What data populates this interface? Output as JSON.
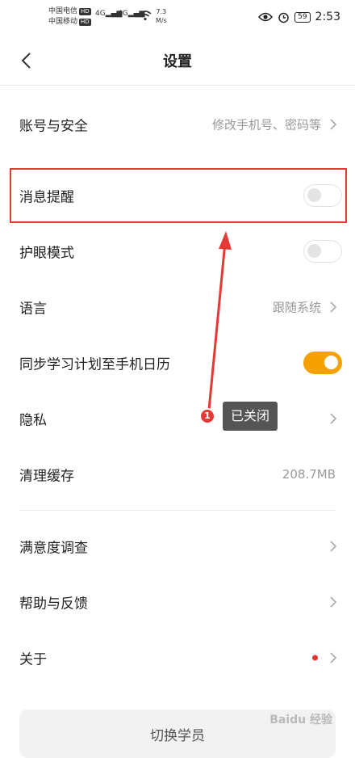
{
  "status_bar": {
    "carrier1": "中国电信",
    "carrier2": "中国移动",
    "hd": "HD",
    "net1": "4G",
    "net2": "4G",
    "speed_value": "7.3",
    "speed_unit": "M/s",
    "battery": "59",
    "time": "2:53"
  },
  "nav": {
    "title": "设置"
  },
  "rows": [
    {
      "label": "账号与安全",
      "value": "修改手机号、密码等"
    },
    {
      "label": "消息提醒",
      "toggle": false
    },
    {
      "label": "护眼模式",
      "toggle": false
    },
    {
      "label": "语言",
      "value": "跟随系统"
    },
    {
      "label": "同步学习计划至手机日历",
      "toggle": true
    },
    {
      "label": "隐私"
    },
    {
      "label": "清理缓存",
      "value": "208.7MB"
    },
    {
      "label": "满意度调查"
    },
    {
      "label": "帮助与反馈"
    },
    {
      "label": "关于",
      "badge": true
    }
  ],
  "annotation": {
    "marker": "1",
    "tooltip": "已关闭"
  },
  "footer": {
    "switch_label": "切换学员",
    "watermark": "Baidu 经验"
  },
  "colors": {
    "accent": "#f5a100",
    "annotation_red": "#e53935",
    "badge_red": "#e8342d"
  }
}
